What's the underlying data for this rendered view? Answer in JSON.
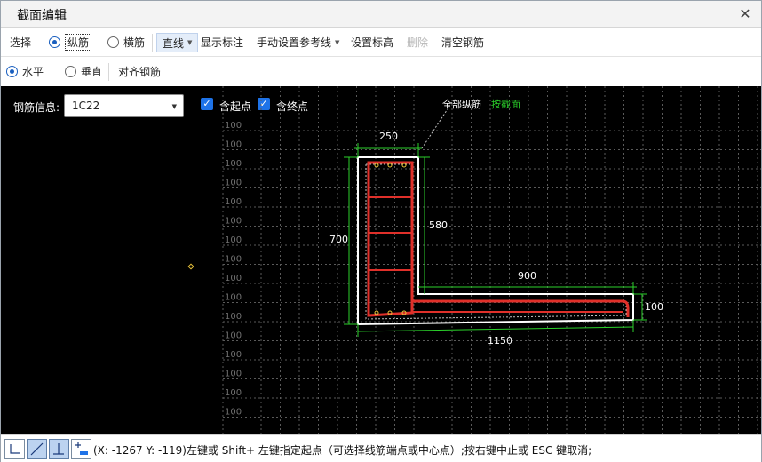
{
  "window": {
    "title": "截面编辑"
  },
  "toolbar1": {
    "select": "选择",
    "longitudinal": "纵筋",
    "transverse": "横筋",
    "line_mode": "直线",
    "show_annotation": "显示标注",
    "manual_ref_line": "手动设置参考线",
    "set_elevation": "设置标高",
    "delete": "删除",
    "clear_rebar": "清空钢筋"
  },
  "toolbar2": {
    "horizontal": "水平",
    "vertical": "垂直",
    "align_rebar": "对齐钢筋"
  },
  "canvas": {
    "rebar_info_label": "钢筋信息:",
    "rebar_info_value": "1C22",
    "include_start": "含起点",
    "include_end": "含终点",
    "all_longitudinal": "全部纵筋",
    "by_section": "按截面",
    "grid_label": "100",
    "dim_250": "250",
    "dim_580": "580",
    "dim_700": "700",
    "dim_900": "900",
    "dim_100": "100",
    "dim_1150": "1150",
    "colors": {
      "background": "#000000",
      "outline": "#ffffff",
      "rebar": "#e0302a",
      "dimension": "#2bd12b",
      "grid": "#5a5a5a"
    }
  },
  "statusbar": {
    "coords": "(X: -1267 Y: -119)",
    "hint": "左键或 Shift+ 左键指定起点（可选择线筋端点或中心点）;按右键中止或 ESC 键取消;"
  }
}
